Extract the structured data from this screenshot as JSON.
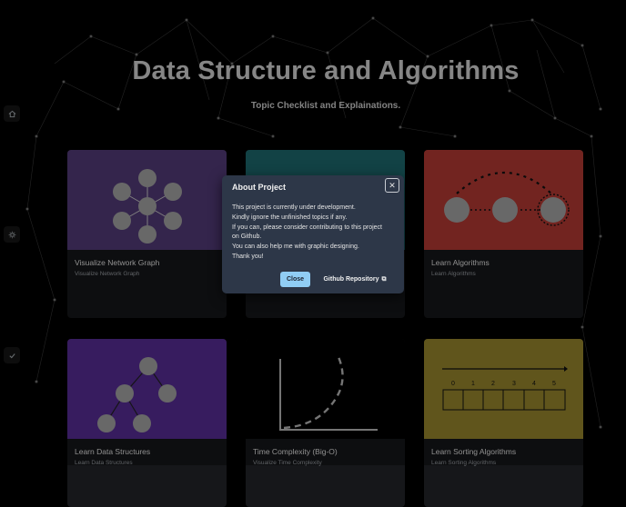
{
  "hero": {
    "title": "Data Structure and Algorithms",
    "subtitle": "Topic Checklist and Explainations."
  },
  "sidebar": {
    "icons": [
      "home-icon",
      "settings-icon",
      "check-icon"
    ]
  },
  "cards": [
    {
      "title": "Visualize Network Graph",
      "subtitle": "Visualize Network Graph",
      "color": "#553c7b"
    },
    {
      "title": "",
      "subtitle": "",
      "color": "#1e6b70"
    },
    {
      "title": "Learn Algorithms",
      "subtitle": "Learn Algorithms",
      "color": "#b83a35"
    },
    {
      "title": "Learn Data Structures",
      "subtitle": "Learn Data Structures",
      "color": "#5a2e9a"
    },
    {
      "title": "Time Complexity (Big-O)",
      "subtitle": "Visualize Time Complexity",
      "color": "#000000"
    },
    {
      "title": "Learn Sorting Algorithms",
      "subtitle": "Learn Sorting Algorithms",
      "color": "#9c8a2e"
    }
  ],
  "sorting_indices": [
    "0",
    "1",
    "2",
    "3",
    "4",
    "5"
  ],
  "modal": {
    "title": "About Project",
    "lines": [
      "This project is currently under development.",
      "Kindly ignore the unfinished topics if any.",
      "If you can, please consider contributing to this project",
      "on Github.",
      "You can also help me with graphic designing.",
      "Thank you!"
    ],
    "close_label": "Close",
    "github_label": "Github Repository"
  },
  "colors": {
    "primary_button": "#90cdf4",
    "modal_bg": "#2d3748"
  }
}
